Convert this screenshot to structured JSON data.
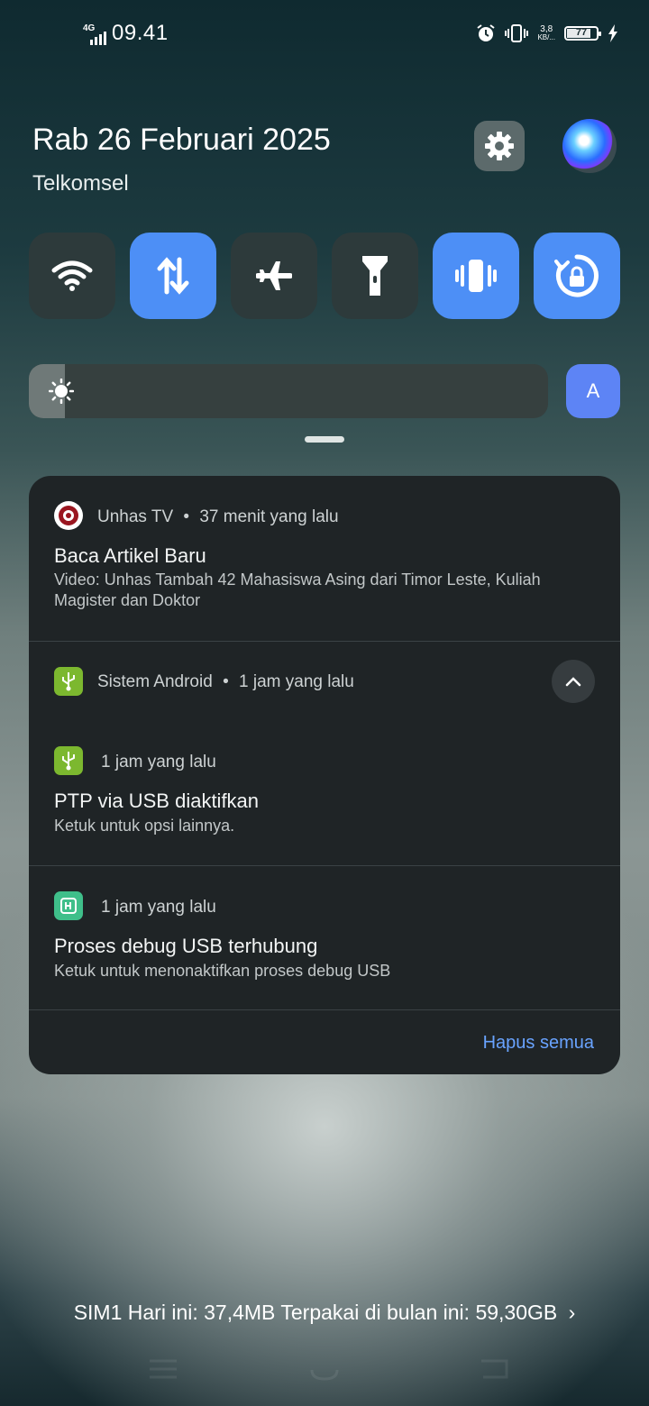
{
  "status_bar": {
    "network_type": "4G",
    "time": "09.41",
    "netspeed_value": "3,8",
    "netspeed_unit": "KB/...",
    "battery_level": "77",
    "icons": [
      "alarm-icon",
      "vibrate-icon",
      "charging-icon"
    ]
  },
  "header": {
    "date": "Rab 26 Februari 2025",
    "carrier": "Telkomsel"
  },
  "quick_tiles": [
    {
      "name": "wifi",
      "icon": "wifi-icon",
      "active": false
    },
    {
      "name": "mobile-data",
      "icon": "data-arrows-icon",
      "active": true
    },
    {
      "name": "airplane-mode",
      "icon": "airplane-icon",
      "active": false
    },
    {
      "name": "flashlight",
      "icon": "flashlight-icon",
      "active": false
    },
    {
      "name": "vibrate",
      "icon": "vibrate-icon",
      "active": true
    },
    {
      "name": "auto-rotate-lock",
      "icon": "rotate-lock-icon",
      "active": true
    }
  ],
  "brightness": {
    "level_percent": 7,
    "auto_label": "A"
  },
  "notifications": {
    "unhas": {
      "app": "Unhas TV",
      "time": "37 menit yang lalu",
      "title": "Baca Artikel Baru",
      "body": "Video: Unhas Tambah 42 Mahasiswa Asing dari Timor Leste, Kuliah Magister dan Doktor"
    },
    "android_group": {
      "app": "Sistem Android",
      "time": "1 jam yang lalu"
    },
    "ptp": {
      "time": "1 jam yang lalu",
      "title": "PTP via USB diaktifkan",
      "body": "Ketuk untuk opsi lainnya."
    },
    "debug": {
      "time": "1 jam yang lalu",
      "title": "Proses debug USB terhubung",
      "body": "Ketuk untuk menonaktifkan proses debug USB"
    },
    "clear_all_label": "Hapus semua"
  },
  "data_usage": {
    "text": "SIM1 Hari ini: 37,4MB Terpakai di bulan ini: 59,30GB"
  },
  "colors": {
    "accent": "#4d8ff6",
    "tile_inactive": "#2d3a3b",
    "card_bg": "#1f2426",
    "link": "#69a3ff",
    "android_green": "#7cb82f"
  }
}
